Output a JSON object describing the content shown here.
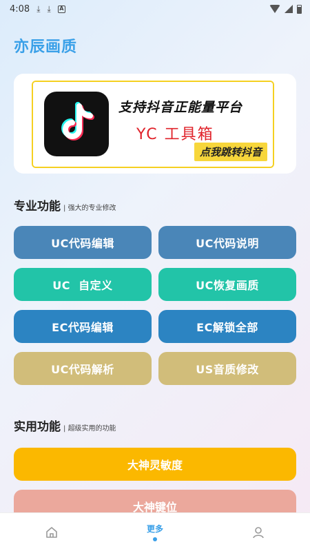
{
  "status_bar": {
    "time": "4:08",
    "icons": [
      "download-icon",
      "download-icon",
      "a-icon",
      "wifi-icon",
      "signal-icon",
      "battery-icon"
    ]
  },
  "app": {
    "title": "亦辰画质"
  },
  "banner": {
    "headline": "支持抖音正能量平台",
    "subtitle": "YC 工具箱",
    "cta": "点我跳转抖音",
    "logo": "tiktok-logo"
  },
  "sections": {
    "pro": {
      "title": "专业功能",
      "subtitle": "强大的专业修改"
    },
    "practical": {
      "title": "实用功能",
      "subtitle": "超级实用的功能"
    }
  },
  "pro_buttons": [
    {
      "label": "UC代码编辑",
      "color": "#4a86b8"
    },
    {
      "label": "UC代码说明",
      "color": "#4a86b8"
    },
    {
      "label": "UC  自定义",
      "color": "#22c4a8"
    },
    {
      "label": "UC恢复画质",
      "color": "#22c4a8"
    },
    {
      "label": "EC代码编辑",
      "color": "#2c84c2"
    },
    {
      "label": "EC解锁全部",
      "color": "#2c84c2"
    },
    {
      "label": "UC代码解析",
      "color": "#d1bd7a"
    },
    {
      "label": "US音质修改",
      "color": "#d1bd7a"
    }
  ],
  "practical_buttons": [
    {
      "label": "大神灵敏度",
      "color": "#fbb800"
    },
    {
      "label": "大神键位",
      "color": "#eba89c"
    }
  ],
  "bottom_nav": {
    "items": [
      {
        "icon": "home-icon",
        "label": ""
      },
      {
        "icon": "",
        "label": "更多"
      },
      {
        "icon": "user-icon",
        "label": ""
      }
    ],
    "active_color": "#3aa0e8"
  }
}
